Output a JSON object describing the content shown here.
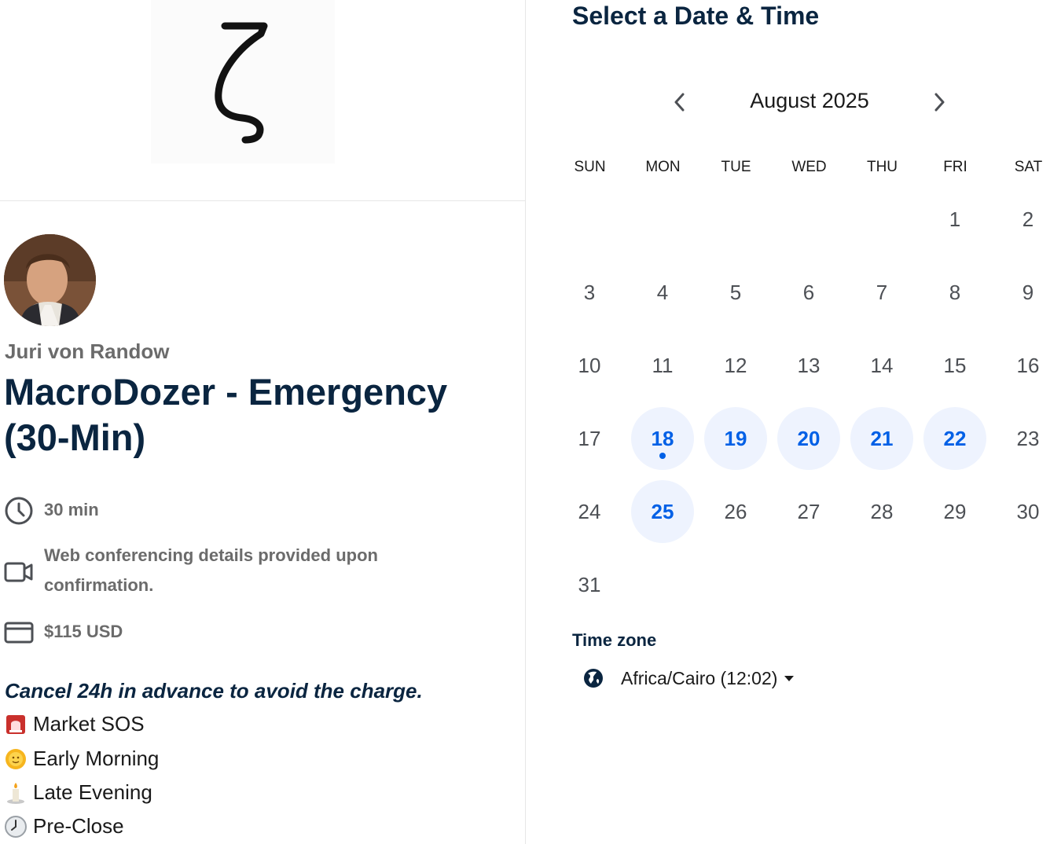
{
  "logo": {
    "glyph": "ζ",
    "icon": "zeta-logo-icon"
  },
  "host": {
    "name": "Juri von Randow",
    "avatar_icon": "host-avatar"
  },
  "event": {
    "title": "MacroDozer - Emergency (30-Min)",
    "duration": "30 min",
    "conferencing": "Web conferencing details provided upon confirmation.",
    "price": "$115 USD",
    "cancel_note": "Cancel 24h in advance to avoid the charge.",
    "notes": [
      {
        "emoji": "rotating-light-icon",
        "label": "Market SOS"
      },
      {
        "emoji": "sun-with-face-icon",
        "label": "Early Morning"
      },
      {
        "emoji": "candle-icon",
        "label": "Late Evening"
      },
      {
        "emoji": "clock-icon",
        "label": "Pre-Close"
      }
    ]
  },
  "calendar": {
    "heading": "Select a Date & Time",
    "month_label": "August 2025",
    "weekdays": [
      "SUN",
      "MON",
      "TUE",
      "WED",
      "THU",
      "FRI",
      "SAT"
    ],
    "days": [
      "1",
      "2",
      "3",
      "4",
      "5",
      "6",
      "7",
      "8",
      "9",
      "10",
      "11",
      "12",
      "13",
      "14",
      "15",
      "16",
      "17",
      "18",
      "19",
      "20",
      "21",
      "22",
      "23",
      "24",
      "25",
      "26",
      "27",
      "28",
      "29",
      "30",
      "31"
    ],
    "first_weekday_index": 5,
    "available_days": [
      18,
      19,
      20,
      21,
      22,
      25
    ],
    "today": 18
  },
  "timezone": {
    "label": "Time zone",
    "value": "Africa/Cairo (12:02)"
  },
  "colors": {
    "primary_text": "#0a2540",
    "accent_blue": "#0060e6",
    "available_bg": "#eef3fe",
    "muted_text": "#6b6b6b"
  }
}
